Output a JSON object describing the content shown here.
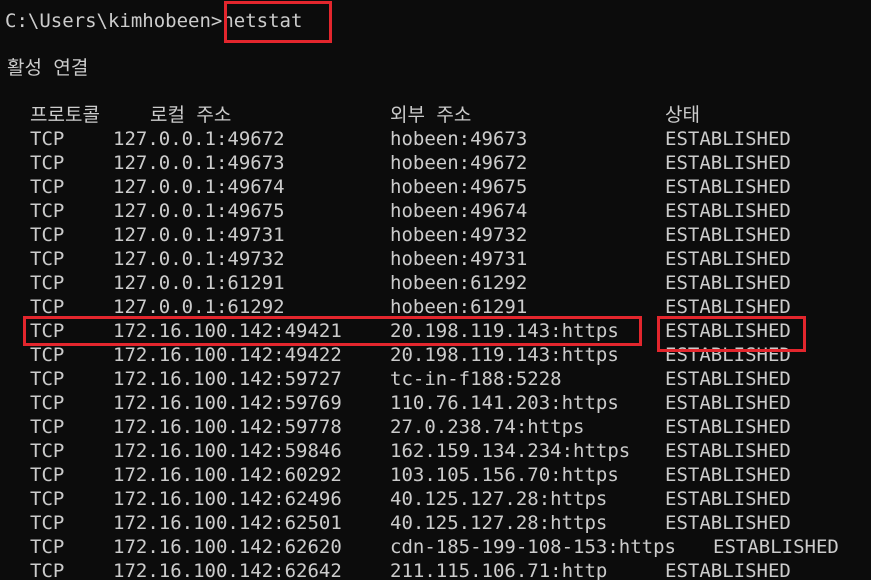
{
  "prompt": {
    "path": "C:\\Users\\kimhobeen>",
    "command": "netstat"
  },
  "section_title": "활성 연결",
  "table": {
    "headers": {
      "protocol": "프로토콜",
      "local_address": "로컬 주소",
      "foreign_address": "외부 주소",
      "state": "상태"
    },
    "rows": [
      {
        "protocol": "TCP",
        "local": "127.0.0.1:49672",
        "foreign": "hobeen:49673",
        "state": "ESTABLISHED"
      },
      {
        "protocol": "TCP",
        "local": "127.0.0.1:49673",
        "foreign": "hobeen:49672",
        "state": "ESTABLISHED"
      },
      {
        "protocol": "TCP",
        "local": "127.0.0.1:49674",
        "foreign": "hobeen:49675",
        "state": "ESTABLISHED"
      },
      {
        "protocol": "TCP",
        "local": "127.0.0.1:49675",
        "foreign": "hobeen:49674",
        "state": "ESTABLISHED"
      },
      {
        "protocol": "TCP",
        "local": "127.0.0.1:49731",
        "foreign": "hobeen:49732",
        "state": "ESTABLISHED"
      },
      {
        "protocol": "TCP",
        "local": "127.0.0.1:49732",
        "foreign": "hobeen:49731",
        "state": "ESTABLISHED"
      },
      {
        "protocol": "TCP",
        "local": "127.0.0.1:61291",
        "foreign": "hobeen:61292",
        "state": "ESTABLISHED"
      },
      {
        "protocol": "TCP",
        "local": "127.0.0.1:61292",
        "foreign": "hobeen:61291",
        "state": "ESTABLISHED"
      },
      {
        "protocol": "TCP",
        "local": "172.16.100.142:49421",
        "foreign": "20.198.119.143:https",
        "state": "ESTABLISHED"
      },
      {
        "protocol": "TCP",
        "local": "172.16.100.142:49422",
        "foreign": "20.198.119.143:https",
        "state": "ESTABLISHED"
      },
      {
        "protocol": "TCP",
        "local": "172.16.100.142:59727",
        "foreign": "tc-in-f188:5228",
        "state": "ESTABLISHED"
      },
      {
        "protocol": "TCP",
        "local": "172.16.100.142:59769",
        "foreign": "110.76.141.203:https",
        "state": "ESTABLISHED"
      },
      {
        "protocol": "TCP",
        "local": "172.16.100.142:59778",
        "foreign": "27.0.238.74:https",
        "state": "ESTABLISHED"
      },
      {
        "protocol": "TCP",
        "local": "172.16.100.142:59846",
        "foreign": "162.159.134.234:https",
        "state": "ESTABLISHED"
      },
      {
        "protocol": "TCP",
        "local": "172.16.100.142:60292",
        "foreign": "103.105.156.70:https",
        "state": "ESTABLISHED"
      },
      {
        "protocol": "TCP",
        "local": "172.16.100.142:62496",
        "foreign": "40.125.127.28:https",
        "state": "ESTABLISHED"
      },
      {
        "protocol": "TCP",
        "local": "172.16.100.142:62501",
        "foreign": "40.125.127.28:https",
        "state": "ESTABLISHED"
      },
      {
        "protocol": "TCP",
        "local": "172.16.100.142:62620",
        "foreign": "cdn-185-199-108-153:https",
        "state": "ESTABLISHED"
      },
      {
        "protocol": "TCP",
        "local": "172.16.100.142:62642",
        "foreign": "211.115.106.71:http",
        "state": "ESTABLISHED"
      }
    ]
  },
  "colors": {
    "background": "#0c0c0c",
    "text": "#cccccc",
    "highlight": "#e3262d"
  }
}
